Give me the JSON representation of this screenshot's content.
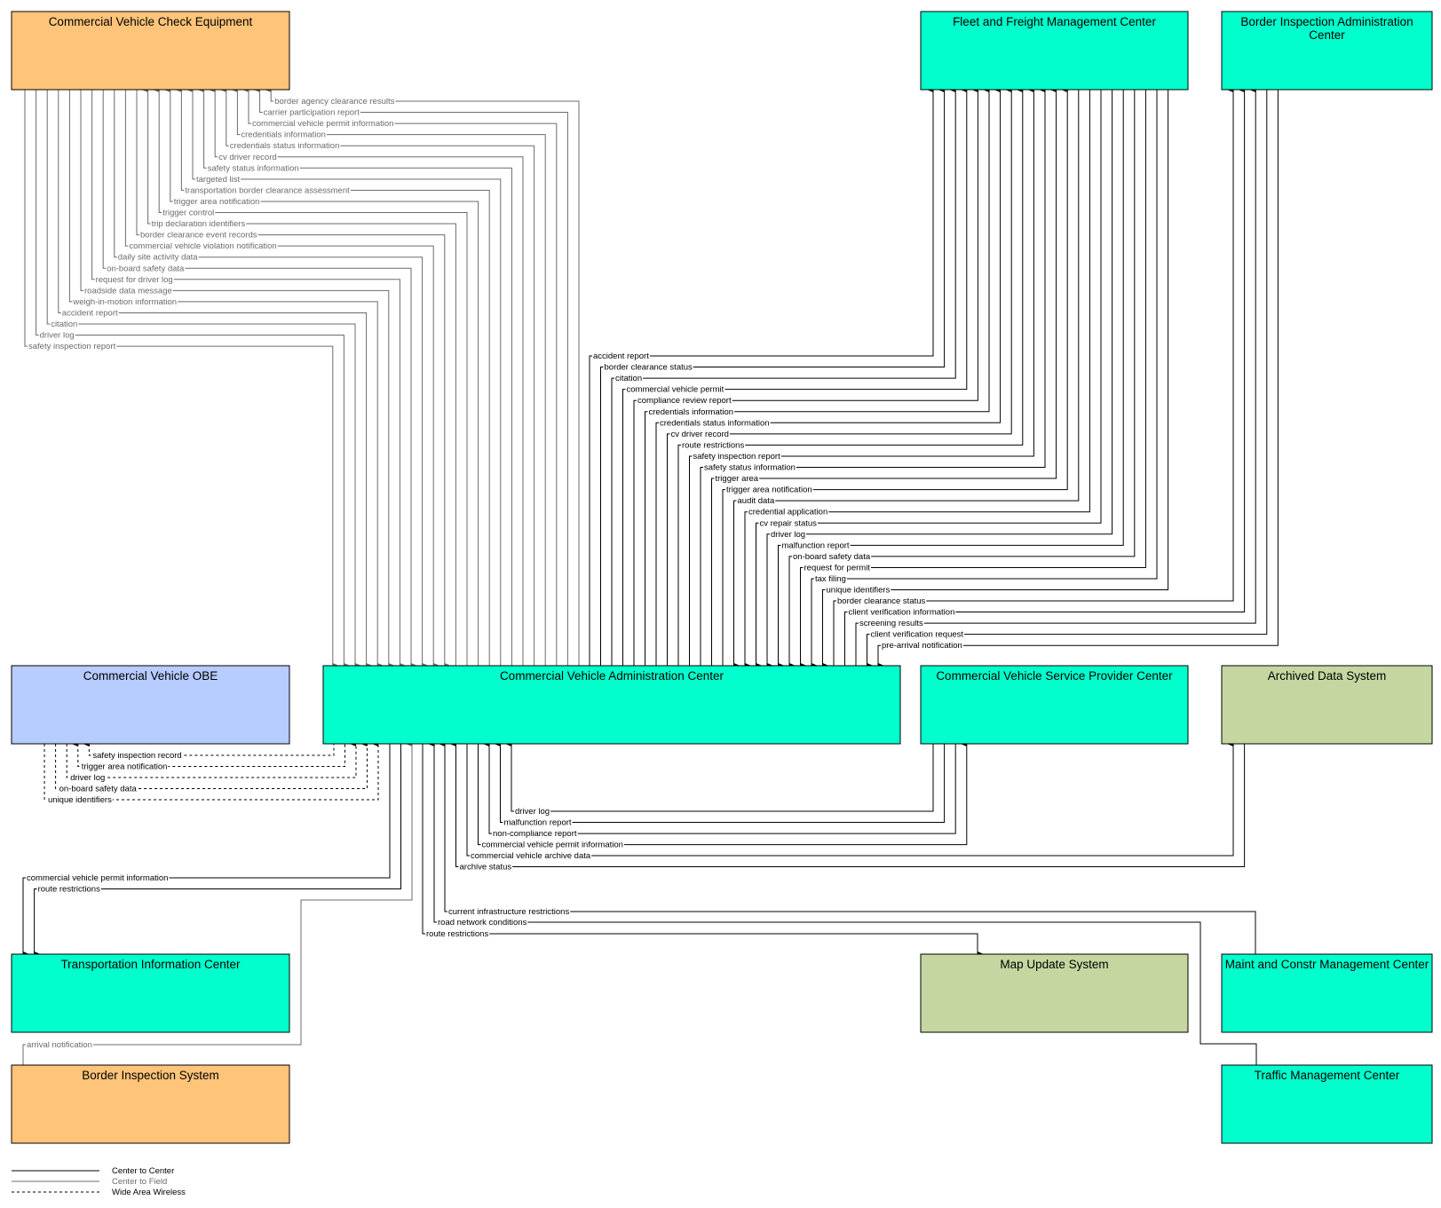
{
  "colors": {
    "center": "#00ffcc",
    "field": "#fec47a",
    "vehicle": "#b7ccff",
    "support": "#c5d6a0",
    "c2c": "#000000",
    "c2f": "#6b6b6b",
    "border": "#000000"
  },
  "elements": [
    {
      "id": "cvce",
      "label": [
        "Commercial Vehicle Check Equipment"
      ],
      "kind": "field"
    },
    {
      "id": "ffmc",
      "label": [
        "Fleet and Freight Management Center"
      ],
      "kind": "center"
    },
    {
      "id": "biac",
      "label": [
        "Border Inspection Administration",
        "Center"
      ],
      "kind": "center"
    },
    {
      "id": "obe",
      "label": [
        "Commercial Vehicle OBE"
      ],
      "kind": "vehicle"
    },
    {
      "id": "cvac",
      "label": [
        "Commercial Vehicle Administration Center"
      ],
      "kind": "center"
    },
    {
      "id": "cvspc",
      "label": [
        "Commercial Vehicle Service Provider Center"
      ],
      "kind": "center"
    },
    {
      "id": "ads",
      "label": [
        "Archived Data System"
      ],
      "kind": "support"
    },
    {
      "id": "tic",
      "label": [
        "Transportation Information Center"
      ],
      "kind": "center"
    },
    {
      "id": "mus",
      "label": [
        "Map Update System"
      ],
      "kind": "support"
    },
    {
      "id": "mcmc",
      "label": [
        "Maint and Constr Management Center"
      ],
      "kind": "center"
    },
    {
      "id": "bis",
      "label": [
        "Border Inspection System"
      ],
      "kind": "field"
    },
    {
      "id": "tmc",
      "label": [
        "Traffic Management Center"
      ],
      "kind": "center"
    }
  ],
  "flows": {
    "cvce_cvac": [
      {
        "label": "border agency clearance results",
        "dir": "to_cvce"
      },
      {
        "label": "carrier participation report",
        "dir": "to_cvce"
      },
      {
        "label": "commercial vehicle permit information",
        "dir": "to_cvce"
      },
      {
        "label": "credentials information",
        "dir": "to_cvce"
      },
      {
        "label": "credentials status information",
        "dir": "to_cvce"
      },
      {
        "label": "cv driver record",
        "dir": "to_cvce"
      },
      {
        "label": "safety status information",
        "dir": "to_cvce"
      },
      {
        "label": "targeted list",
        "dir": "to_cvce"
      },
      {
        "label": "transportation border clearance assessment",
        "dir": "to_cvce"
      },
      {
        "label": "trigger area notification",
        "dir": "to_cvce"
      },
      {
        "label": "trigger control",
        "dir": "to_cvce"
      },
      {
        "label": "trip declaration identifiers",
        "dir": "to_cvce"
      },
      {
        "label": "border clearance event records",
        "dir": "to_cvac"
      },
      {
        "label": "commercial vehicle violation notification",
        "dir": "to_cvac"
      },
      {
        "label": "daily site activity data",
        "dir": "to_cvac"
      },
      {
        "label": "on-board safety data",
        "dir": "to_cvac"
      },
      {
        "label": "request for driver log",
        "dir": "to_cvac"
      },
      {
        "label": "roadside data message",
        "dir": "to_cvac"
      },
      {
        "label": "weigh-in-motion information",
        "dir": "to_cvac"
      },
      {
        "label": "accident report",
        "dir": "to_cvac"
      },
      {
        "label": "citation",
        "dir": "to_cvac"
      },
      {
        "label": "driver log",
        "dir": "to_cvac"
      },
      {
        "label": "safety inspection report",
        "dir": "to_cvac"
      }
    ],
    "cvac_ffmc": [
      {
        "label": "accident report",
        "dir": "to_top"
      },
      {
        "label": "border clearance status",
        "dir": "to_top"
      },
      {
        "label": "citation",
        "dir": "to_top"
      },
      {
        "label": "commercial vehicle permit",
        "dir": "to_top"
      },
      {
        "label": "compliance review report",
        "dir": "to_top"
      },
      {
        "label": "credentials information",
        "dir": "to_top"
      },
      {
        "label": "credentials status information",
        "dir": "to_top"
      },
      {
        "label": "cv driver record",
        "dir": "to_top"
      },
      {
        "label": "route restrictions",
        "dir": "to_top"
      },
      {
        "label": "safety inspection report",
        "dir": "to_top"
      },
      {
        "label": "safety status information",
        "dir": "to_top"
      },
      {
        "label": "trigger area",
        "dir": "to_top"
      },
      {
        "label": "trigger area notification",
        "dir": "to_top"
      },
      {
        "label": "audit data",
        "dir": "to_cvac"
      },
      {
        "label": "credential application",
        "dir": "to_cvac"
      },
      {
        "label": "cv repair status",
        "dir": "to_cvac"
      },
      {
        "label": "driver log",
        "dir": "to_cvac"
      },
      {
        "label": "malfunction report",
        "dir": "to_cvac"
      },
      {
        "label": "on-board safety data",
        "dir": "to_cvac"
      },
      {
        "label": "request for permit",
        "dir": "to_cvac"
      },
      {
        "label": "tax filing",
        "dir": "to_cvac"
      },
      {
        "label": "unique identifiers",
        "dir": "to_cvac"
      }
    ],
    "cvac_biac": [
      {
        "label": "border clearance status",
        "dir": "to_top"
      },
      {
        "label": "client verification information",
        "dir": "to_top"
      },
      {
        "label": "screening results",
        "dir": "to_top"
      },
      {
        "label": "client verification request",
        "dir": "to_cvac"
      },
      {
        "label": "pre-arrival notification",
        "dir": "to_cvac"
      }
    ],
    "obe_cvac": [
      {
        "label": "safety inspection record",
        "dir": "to_obe"
      },
      {
        "label": "trigger area notification",
        "dir": "to_obe"
      },
      {
        "label": "driver log",
        "dir": "to_cvac"
      },
      {
        "label": "on-board safety data",
        "dir": "to_cvac"
      },
      {
        "label": "unique identifiers",
        "dir": "to_cvac"
      }
    ],
    "cvac_cvspc": [
      {
        "label": "driver log",
        "dir": "to_cvac"
      },
      {
        "label": "malfunction report",
        "dir": "to_cvac"
      },
      {
        "label": "non-compliance report",
        "dir": "to_cvac"
      },
      {
        "label": "commercial vehicle permit information",
        "dir": "to_cvspc"
      }
    ],
    "cvac_ads": [
      {
        "label": "commercial vehicle archive data",
        "dir": "to_ads"
      },
      {
        "label": "archive status",
        "dir": "to_cvac"
      }
    ],
    "cvac_tic": [
      {
        "label": "commercial vehicle permit information",
        "dir": "to_tic"
      },
      {
        "label": "route restrictions",
        "dir": "to_tic"
      }
    ],
    "bis_cvac": [
      {
        "label": "arrival notification",
        "dir": "to_cvac"
      }
    ],
    "cvac_mcmc": [
      {
        "label": "current infrastructure restrictions",
        "dir": "to_cvac"
      }
    ],
    "cvac_tmc": [
      {
        "label": "road network conditions",
        "dir": "to_cvac"
      }
    ],
    "cvac_mus": [
      {
        "label": "route restrictions",
        "dir": "to_mus"
      }
    ]
  },
  "legend": [
    {
      "label": "Center to Center",
      "style": "c2c"
    },
    {
      "label": "Center to Field",
      "style": "c2f"
    },
    {
      "label": "Wide Area Wireless",
      "style": "waw"
    }
  ]
}
